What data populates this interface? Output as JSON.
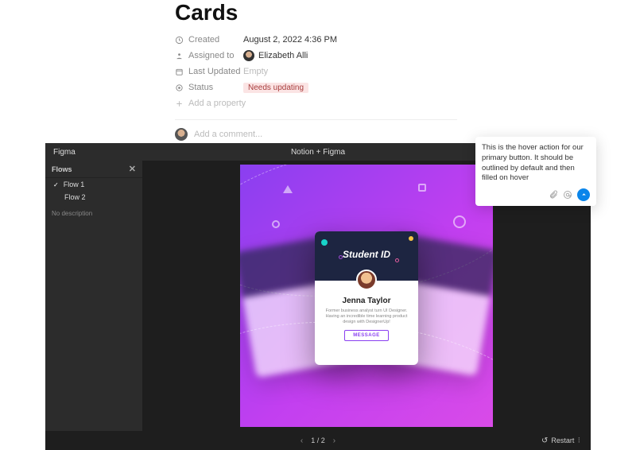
{
  "page": {
    "title": "Cards"
  },
  "props": {
    "created": {
      "label": "Created",
      "value": "August 2, 2022 4:36 PM"
    },
    "assigned": {
      "label": "Assigned to",
      "value": "Elizabeth Alli"
    },
    "updated": {
      "label": "Last Updated",
      "value": "Empty"
    },
    "status": {
      "label": "Status",
      "value": "Needs updating"
    },
    "add": {
      "label": "Add a property"
    }
  },
  "comment_input": {
    "placeholder": "Add a comment..."
  },
  "popover": {
    "text": "This is the hover action for our primary button. It should be outlined by default and then filled on hover"
  },
  "figma": {
    "logo": "Figma",
    "title": "Notion + Figma",
    "flows_header": "Flows",
    "flows": [
      "Flow 1",
      "Flow 2"
    ],
    "no_description": "No description",
    "card": {
      "title": "Student ID",
      "name": "Jenna Taylor",
      "desc": "Former business analyst turn UI Designer. Having an incredible time learning product design with DesignerUp!",
      "button": "MESSAGE"
    },
    "pager": {
      "text": "1 / 2"
    },
    "restart": "Restart"
  }
}
